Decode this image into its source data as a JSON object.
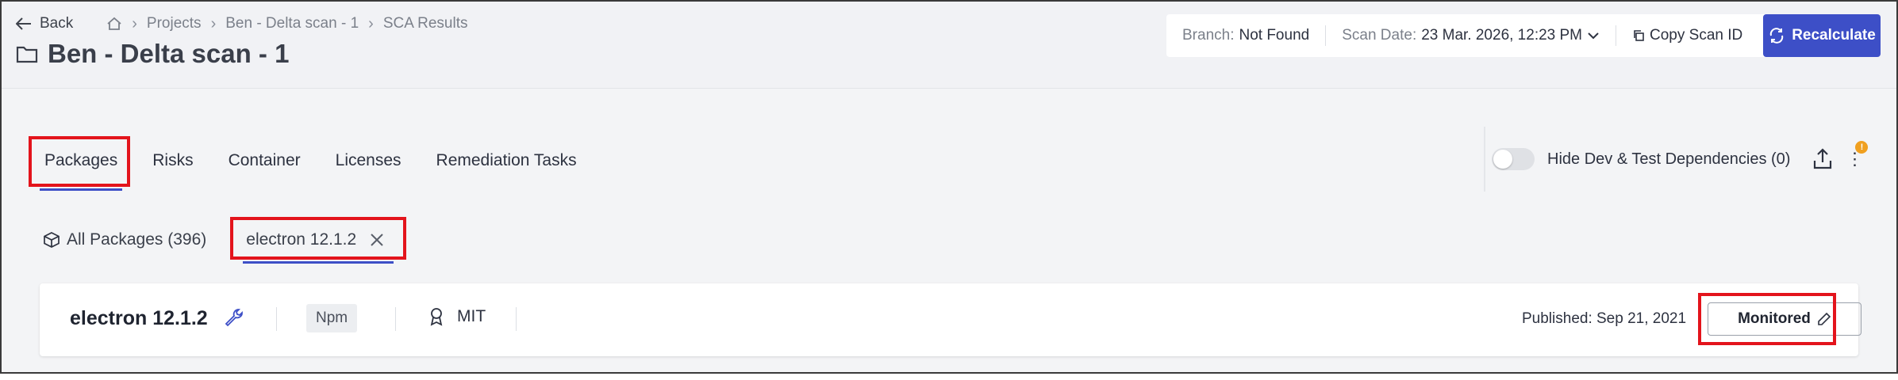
{
  "breadcrumb": {
    "back": "Back",
    "items": [
      "Projects",
      "Ben - Delta scan - 1",
      "SCA Results"
    ]
  },
  "page": {
    "title": "Ben - Delta scan - 1"
  },
  "toolbar": {
    "branch_label": "Branch:",
    "branch_value": "Not Found",
    "scan_date_label": "Scan Date:",
    "scan_date_value": "23 Mar. 2026, 12:23 PM",
    "copy_scan_id": "Copy Scan ID",
    "recalculate": "Recalculate"
  },
  "tabs": [
    "Packages",
    "Risks",
    "Container",
    "Licenses",
    "Remediation Tasks"
  ],
  "controls": {
    "hide_dev_label": "Hide Dev & Test Dependencies (0)",
    "notification_badge": "!"
  },
  "subtabs": {
    "all_packages": "All Packages (396)",
    "selected_filter": "electron 12.1.2"
  },
  "package": {
    "name": "electron 12.1.2",
    "ecosystem": "Npm",
    "license": "MIT",
    "published": "Published: Sep 21, 2021",
    "status": "Monitored"
  },
  "colors": {
    "accent": "#3d4fc7",
    "highlight": "#e3141c",
    "badge": "#f0a020"
  }
}
